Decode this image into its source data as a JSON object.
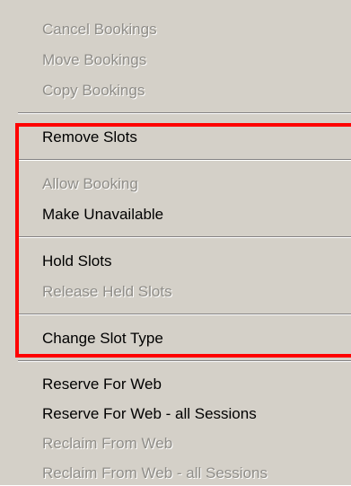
{
  "menu": {
    "booking_items": [
      {
        "label": "Cancel Bookings",
        "enabled": false
      },
      {
        "label": "Move Bookings",
        "enabled": false
      },
      {
        "label": "Copy Bookings",
        "enabled": false
      }
    ],
    "remove_slots_label": "Remove Slots",
    "allow_booking_label": "Allow Booking",
    "make_unavailable_label": "Make Unavailable",
    "hold_slots_label": "Hold Slots",
    "release_held_slots_label": "Release Held Slots",
    "change_slot_type_label": "Change Slot Type",
    "web_items": [
      {
        "label": "Reserve For Web",
        "enabled": true
      },
      {
        "label": "Reserve For Web - all Sessions",
        "enabled": true
      },
      {
        "label": "Reclaim From Web",
        "enabled": false
      },
      {
        "label": "Reclaim From Web - all Sessions",
        "enabled": false
      }
    ]
  },
  "colors": {
    "menu_background": "#d4d0c8",
    "enabled_text": "#000000",
    "disabled_text": "#8f8d88",
    "highlight_border": "#ff0000"
  }
}
